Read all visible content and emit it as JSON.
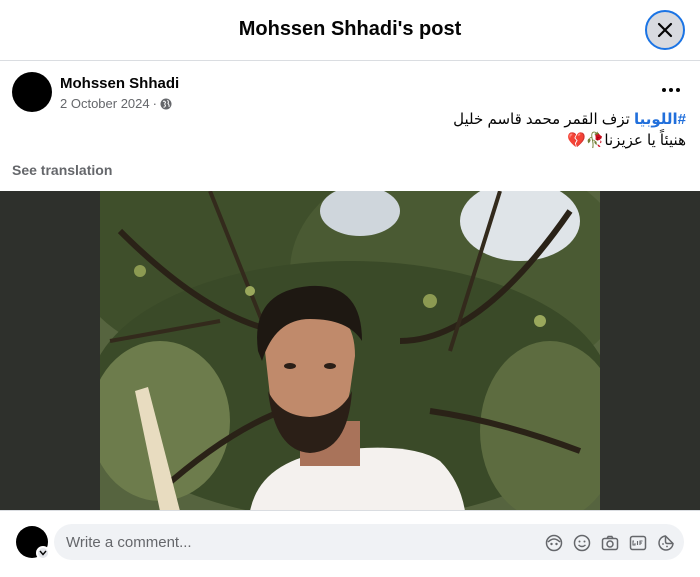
{
  "header": {
    "title": "Mohssen Shhadi's post"
  },
  "post": {
    "author": "Mohssen Shhadi",
    "date": "2 October 2024",
    "separator": "·",
    "hashtag": "#اللوبيا",
    "line1_rest": " تزف القمر محمد قاسم خليل",
    "line2": "هنيئاً يا عزيزنا🥀💔",
    "see_translation": "See translation"
  },
  "comment": {
    "placeholder": "Write a comment..."
  },
  "icons": {
    "close": "close-icon",
    "more": "more-options-icon",
    "privacy": "globe-icon",
    "avatar_menu": "chevron-down-icon",
    "composer": [
      "avatar-sticker-icon",
      "emoji-icon",
      "camera-icon",
      "gif-icon",
      "sticker-icon"
    ]
  },
  "colors": {
    "accent": "#1b74e4",
    "hashtag": "#216fdb",
    "secondary_text": "#65676b",
    "media_bg": "#2e302c"
  }
}
